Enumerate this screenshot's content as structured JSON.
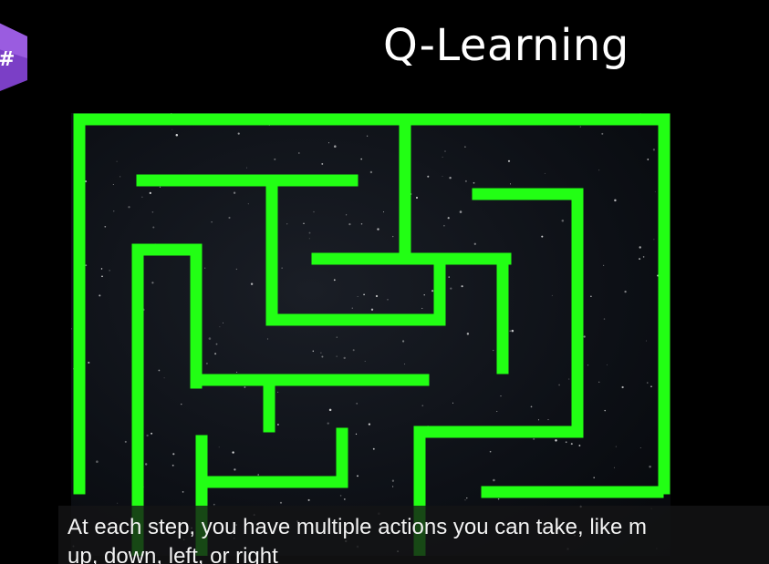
{
  "slide": {
    "title": "Q-Learning",
    "logo_icon": "csharp-logo-icon",
    "maze_icon": "maze-icon",
    "agent_icon": "rocket-icon",
    "goal_icon": "planet-icon"
  },
  "subtitle": {
    "line1": "At each step, you have multiple actions you can take, like m",
    "line2": "up, down, left, or right"
  },
  "colors": {
    "wall": "#22ff14",
    "background": "#000000",
    "caption_bg": "#141416",
    "logo": "#7b3fc6"
  }
}
